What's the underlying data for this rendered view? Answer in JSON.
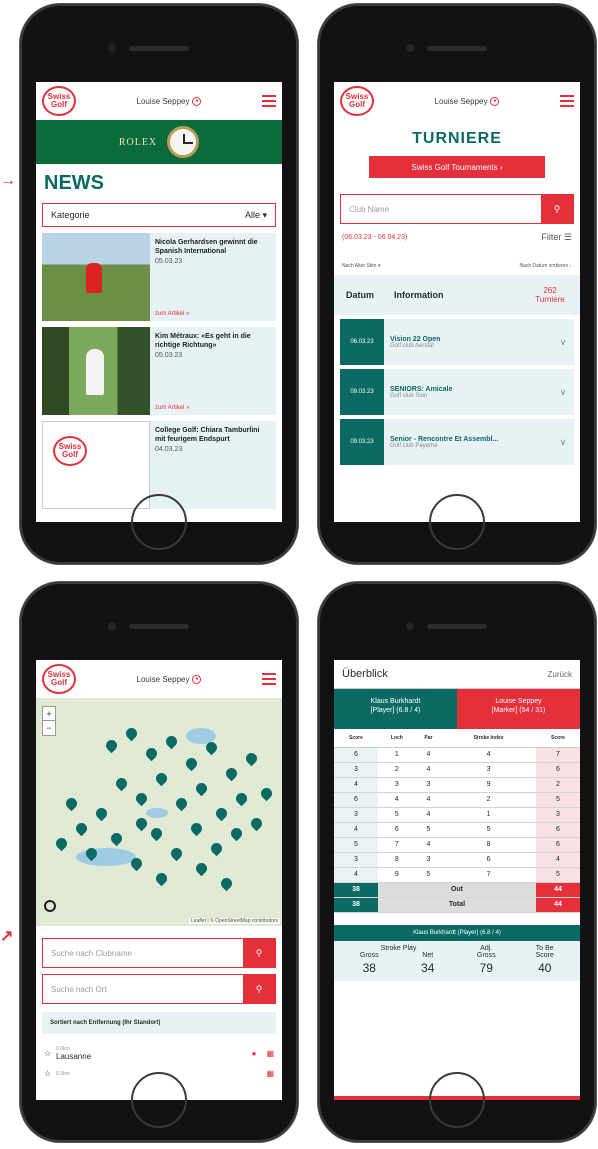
{
  "common": {
    "logo_line1": "Swiss",
    "logo_line2": "Golf",
    "user_name": "Louise Seppey"
  },
  "news": {
    "sponsor": "ROLEX",
    "title": "NEWS",
    "category_label": "Kategorie",
    "category_value": "Alle",
    "more_label": "zum Artikel »",
    "items": [
      {
        "headline": "Nicola Gerhardsen gewinnt die Spanish International",
        "date": "05.03.23"
      },
      {
        "headline": "Kim Métraux: «Es geht in die richtige Richtung»",
        "date": "05.03.23"
      },
      {
        "headline": "College Golf: Chiara Tamburlini mit feurigem Endspurt",
        "date": "04.03.23"
      }
    ]
  },
  "tournaments": {
    "title": "TURNIERE",
    "button": "Swiss Golf Tournaments ›",
    "search_placeholder": "Club Name",
    "date_range": "(06.03.23 - 06.04.23)",
    "filter": "Filter",
    "sort_left": "Nach Alter Stim ▾",
    "sort_right": "Nach Datum sortieren ↓",
    "col_date": "Datum",
    "col_info": "Information",
    "count": "262",
    "count_label": "Turniere",
    "rows": [
      {
        "date": "06.03.23",
        "name": "Vision 22 Open",
        "club": "Golf club Aerstal"
      },
      {
        "date": "09.03.23",
        "name": "SENIORS: Amicale",
        "club": "Golf club Sion"
      },
      {
        "date": "09.03.23",
        "name": "Senior - Rencontre Et Assembl...",
        "club": "Golf club Payerne"
      }
    ]
  },
  "map": {
    "zoom_in": "+",
    "zoom_out": "−",
    "attribution": "Leaflet | © OpenStreetMap contributors",
    "search_club": "Suche nach Clubname",
    "search_place": "Suche nach Ort",
    "sorted_label": "Sortiert nach Entfernung (Ihr Standort)",
    "clubs": [
      {
        "distance": "0.0km",
        "name": "Lausanne"
      },
      {
        "distance": "0.3km",
        "name": ""
      }
    ]
  },
  "scorecard": {
    "title": "Überblick",
    "back": "Zurück",
    "player1": "Klaus Burkhardt",
    "player1_sub": "[Player] (6.8 / 4)",
    "player2": "Louise Seppey",
    "player2_sub": "[Marker] (54 / 31)",
    "headers": [
      "Score",
      "Loch",
      "Par",
      "Stroke Index",
      "Score"
    ],
    "rows": [
      [
        "6",
        "1",
        "4",
        "4",
        "7"
      ],
      [
        "3",
        "2",
        "4",
        "3",
        "6"
      ],
      [
        "4",
        "3",
        "3",
        "9",
        "2"
      ],
      [
        "6",
        "4",
        "4",
        "2",
        "5"
      ],
      [
        "3",
        "5",
        "4",
        "1",
        "3"
      ],
      [
        "4",
        "6",
        "5",
        "5",
        "6"
      ],
      [
        "5",
        "7",
        "4",
        "8",
        "6"
      ],
      [
        "3",
        "8",
        "3",
        "6",
        "4"
      ],
      [
        "4",
        "9",
        "5",
        "7",
        "5"
      ]
    ],
    "out_left": "38",
    "out_label": "Out",
    "out_right": "44",
    "total_left": "38",
    "total_label": "Total",
    "total_right": "44",
    "summary_title": "Klaus Burkhardt (Player) (6.8 / 4)",
    "stroke_play": "Stroke Play",
    "adj": "Adj.",
    "to_be": "To Be",
    "gross": "Gross",
    "net": "Net",
    "adj_gross": "Gross",
    "score": "Score",
    "gross_val": "38",
    "net_val": "34",
    "adj_val": "79",
    "score_val": "40"
  }
}
